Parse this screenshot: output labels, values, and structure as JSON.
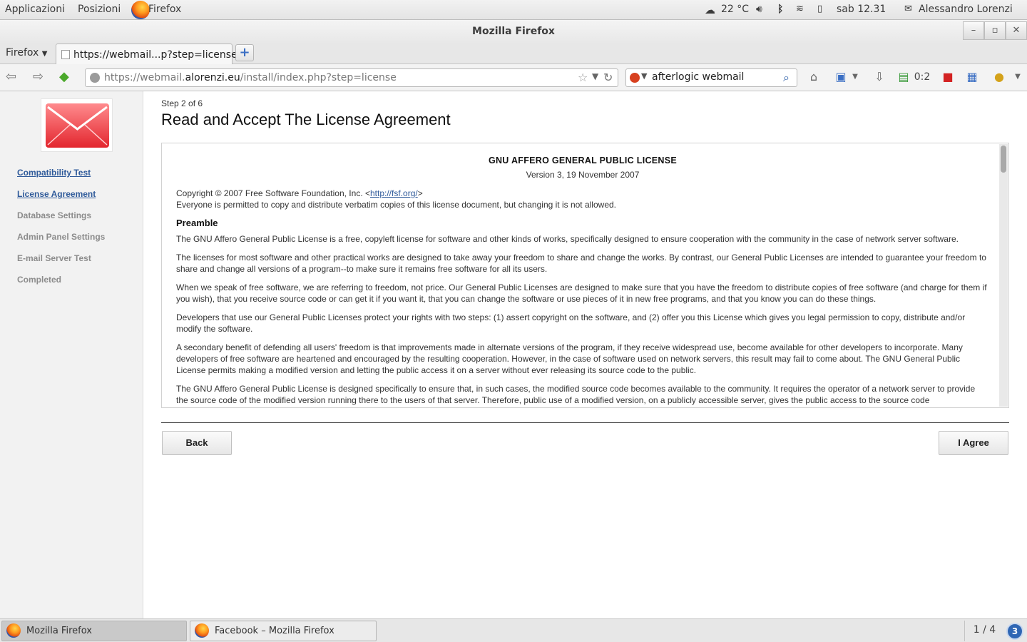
{
  "top_panel": {
    "applications": "Applicazioni",
    "places": "Posizioni",
    "active_app": "Firefox",
    "weather": "22 °C",
    "clock": "sab 12.31",
    "user": "Alessandro Lorenzi"
  },
  "window": {
    "title": "Mozilla Firefox"
  },
  "tabs": {
    "menu_label": "Firefox",
    "active_tab": "https://webmail...p?step=license",
    "new_tab": "+"
  },
  "navbar": {
    "url_prefix": "https://webmail.",
    "url_domain": "alorenzi.eu",
    "url_suffix": "/install/index.php?step=license",
    "search_value": "afterlogic webmail",
    "counter": "0:2"
  },
  "sidebar": {
    "items": [
      {
        "label": "Compatibility Test",
        "state": "done"
      },
      {
        "label": "License Agreement",
        "state": "done"
      },
      {
        "label": "Database Settings",
        "state": "pending"
      },
      {
        "label": "Admin Panel Settings",
        "state": "pending"
      },
      {
        "label": "E-mail Server Test",
        "state": "pending"
      },
      {
        "label": "Completed",
        "state": "pending"
      }
    ]
  },
  "main": {
    "step": "Step 2 of 6",
    "title": "Read and Accept The License Agreement",
    "license": {
      "title": "GNU AFFERO GENERAL PUBLIC LICENSE",
      "version": "Version 3, 19 November 2007",
      "copyright_pre": "Copyright © 2007 Free Software Foundation, Inc. <",
      "copyright_link": "http://fsf.org/",
      "copyright_post": ">",
      "copyright_line2": "Everyone is permitted to copy and distribute verbatim copies of this license document, but changing it is not allowed.",
      "preamble_heading": "Preamble",
      "paragraphs": [
        "The GNU Affero General Public License is a free, copyleft license for software and other kinds of works, specifically designed to ensure cooperation with the community in the case of network server software.",
        "The licenses for most software and other practical works are designed to take away your freedom to share and change the works. By contrast, our General Public Licenses are intended to guarantee your freedom to share and change all versions of a program--to make sure it remains free software for all its users.",
        "When we speak of free software, we are referring to freedom, not price. Our General Public Licenses are designed to make sure that you have the freedom to distribute copies of free software (and charge for them if you wish), that you receive source code or can get it if you want it, that you can change the software or use pieces of it in new free programs, and that you know you can do these things.",
        "Developers that use our General Public Licenses protect your rights with two steps: (1) assert copyright on the software, and (2) offer you this License which gives you legal permission to copy, distribute and/or modify the software.",
        "A secondary benefit of defending all users' freedom is that improvements made in alternate versions of the program, if they receive widespread use, become available for other developers to incorporate. Many developers of free software are heartened and encouraged by the resulting cooperation. However, in the case of software used on network servers, this result may fail to come about. The GNU General Public License permits making a modified version and letting the public access it on a server without ever releasing its source code to the public.",
        "The GNU Affero General Public License is designed specifically to ensure that, in such cases, the modified source code becomes available to the community. It requires the operator of a network server to provide the source code of the modified version running there to the users of that server. Therefore, public use of a modified version, on a publicly accessible server, gives the public access to the source code"
      ]
    },
    "back_label": "Back",
    "agree_label": "I Agree"
  },
  "taskbar": {
    "tasks": [
      "Mozilla Firefox",
      "Facebook – Mozilla Firefox"
    ],
    "workspace": "1 / 4",
    "notifications": "3"
  },
  "colors": {
    "link": "#2f5a9a",
    "accent": "#e3262e"
  }
}
